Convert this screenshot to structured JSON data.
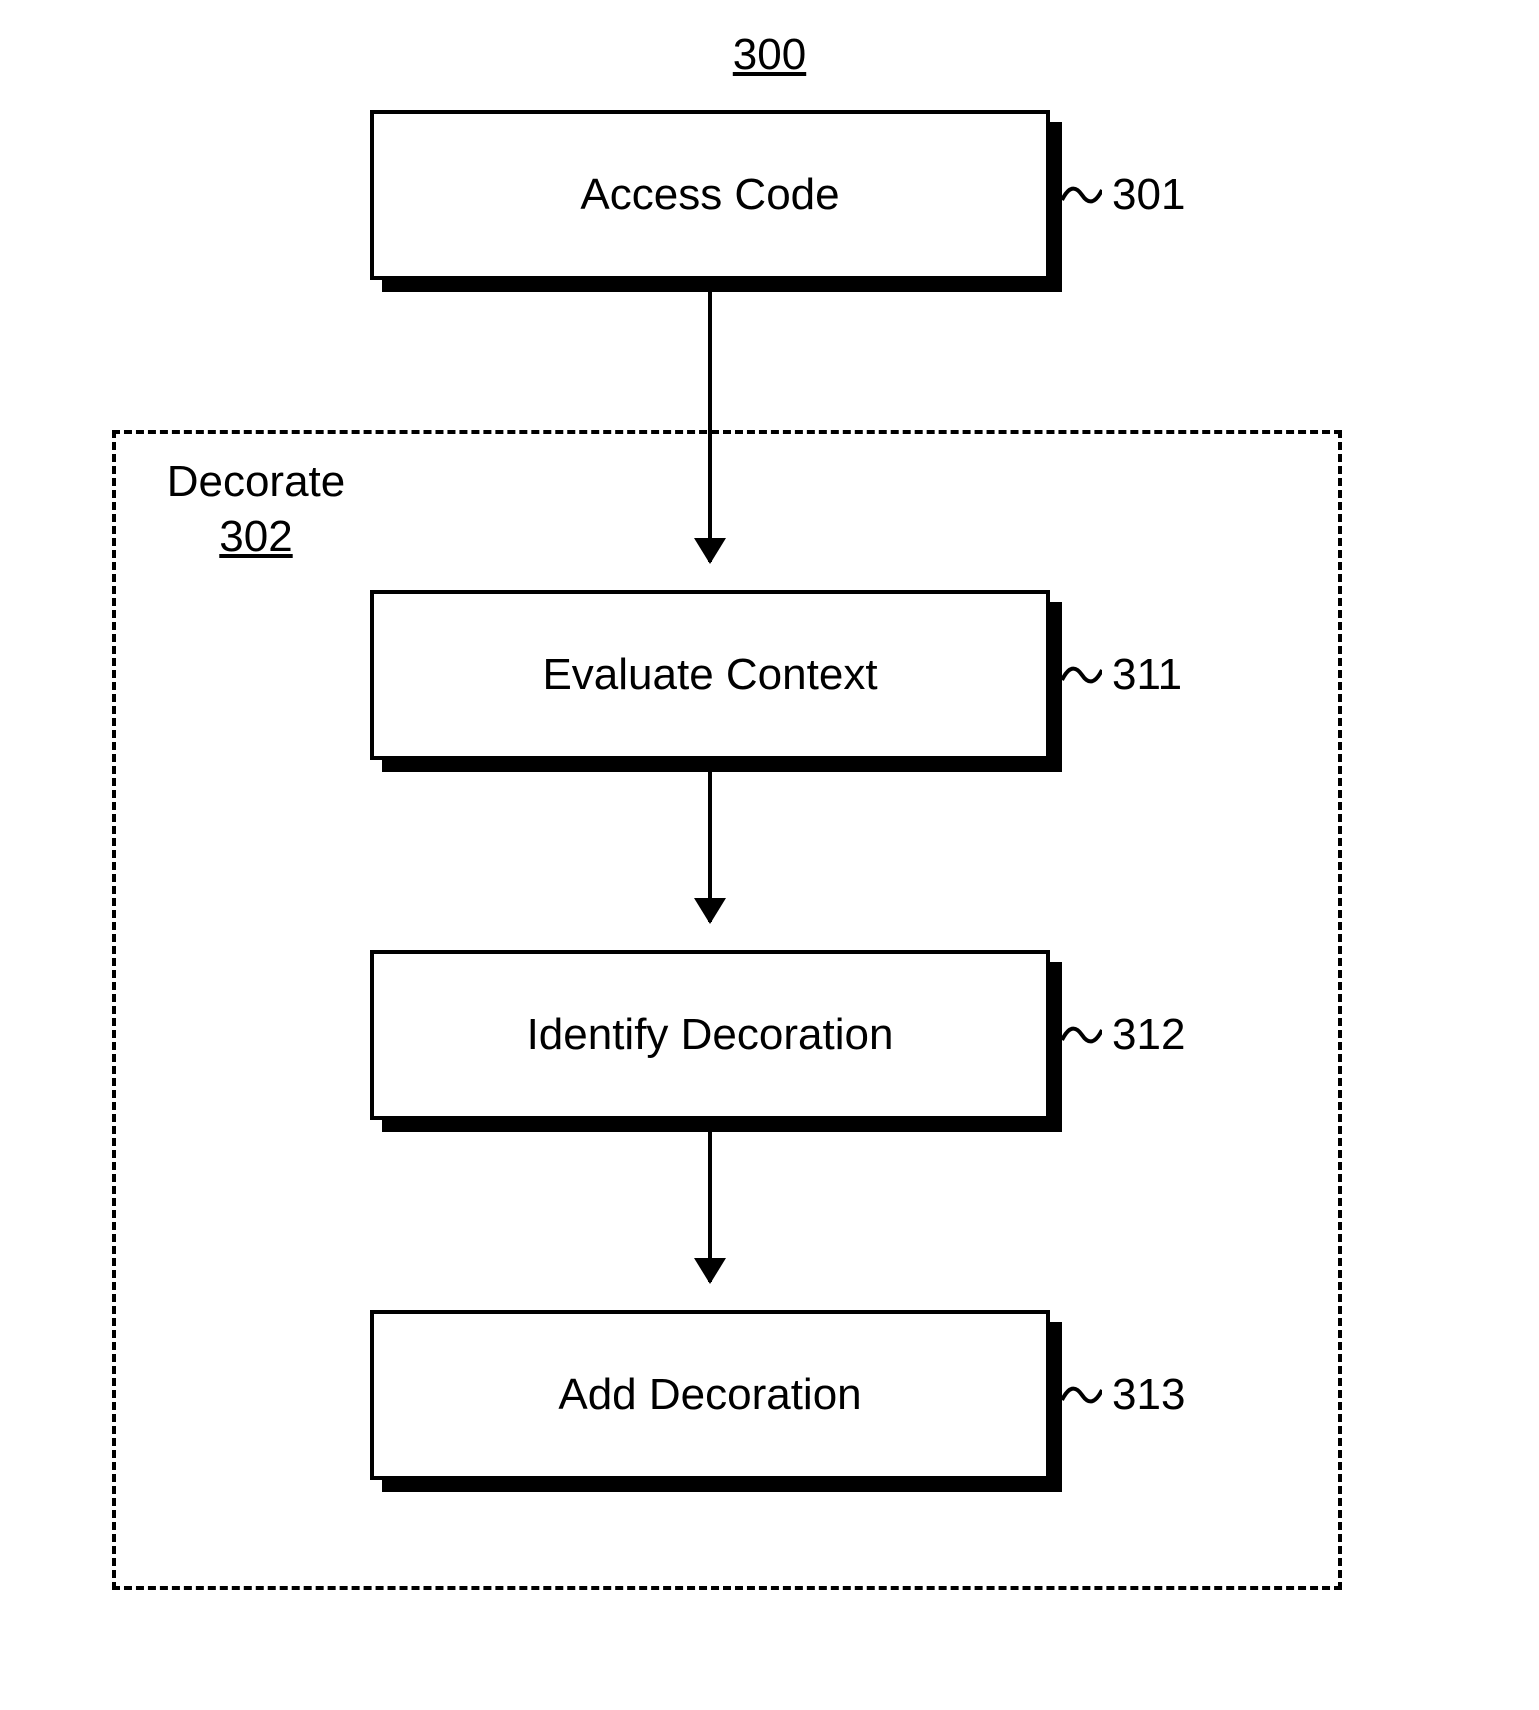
{
  "figure": {
    "number": "300"
  },
  "boxes": {
    "access_code": {
      "label": "Access Code",
      "ref": "301"
    },
    "eval_context": {
      "label": "Evaluate Context",
      "ref": "311"
    },
    "identify_dec": {
      "label": "Identify Decoration",
      "ref": "312"
    },
    "add_dec": {
      "label": "Add Decoration",
      "ref": "313"
    }
  },
  "group": {
    "title": "Decorate",
    "ref": "302"
  }
}
